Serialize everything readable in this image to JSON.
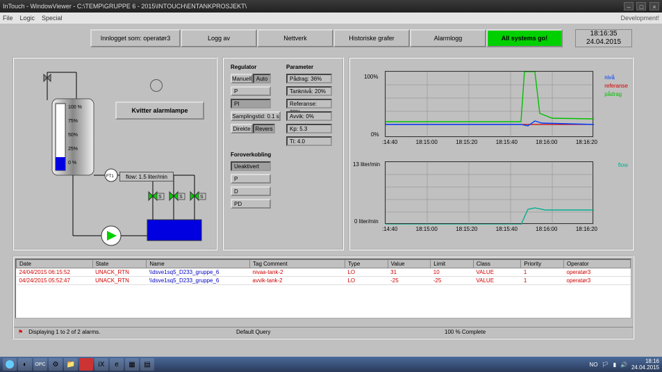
{
  "window": {
    "title": "InTouch - WindowViewer - C:\\TEMP\\GRUPPE 6 - 2015\\INTOUCH\\ENTANKPROSJEKT\\",
    "menu": [
      "File",
      "Logic",
      "Special"
    ],
    "dev": "Development!"
  },
  "topbar": {
    "login": "Innlogget som: operatør3",
    "logoff": "Logg av",
    "network": "Nettverk",
    "hist": "Historiske grafer",
    "alarmlog": "Alarmlogg",
    "status": "All systems go!",
    "time": "18:16:35",
    "date": "24.04.2015"
  },
  "process": {
    "kvitter": "Kvitter alarmlampe",
    "flow": "flow: 1.5 liter/min",
    "ticks": [
      "100 %",
      "75%",
      "50%",
      "25%",
      "0 %"
    ],
    "ft": "FT1"
  },
  "reg": {
    "h1": "Regulator",
    "h2": "Parameter",
    "h3": "Foroverkobling",
    "manuell": "Manuell",
    "auto": "Auto",
    "p": "P",
    "pi": "PI",
    "samp": "Samplingstid: 0.1 s",
    "direkte": "Direkte",
    "revers": "Revers",
    "padrag": "Pådrag: 36%",
    "tanknivaa": "Tanknivå: 20%",
    "ref": "Referanse: 20%",
    "avvik": "Avvik: 0%",
    "kp": "Kp: 5.3",
    "ti": "Ti: 4.0",
    "ff_ua": "Ueaktivert",
    "ff_p": "P",
    "ff_d": "D",
    "ff_pd": "PD"
  },
  "trend": {
    "y100": "100%",
    "y0": "0%",
    "y2a": "13 liter/min",
    "y2b": "0 liter/min",
    "xticks": [
      ":14:40",
      "18:15:00",
      "18:15:20",
      "18:15:40",
      "18:16:00",
      "18:16:20"
    ],
    "leg1": [
      "nivå",
      "referanse",
      "pådrag"
    ],
    "leg1c": [
      "#0040ff",
      "#d00000",
      "#00c000"
    ],
    "leg2": "flow",
    "leg2c": "#00b090"
  },
  "chart_data": [
    {
      "type": "line",
      "title": "",
      "xlabel": "",
      "ylabel": "%",
      "ylim": [
        0,
        100
      ],
      "x": [
        ":14:40",
        "18:15:00",
        "18:15:20",
        "18:15:40",
        "18:15:50",
        "18:16:00",
        "18:16:05",
        "18:16:10",
        "18:16:20",
        "18:16:30"
      ],
      "series": [
        {
          "name": "nivå",
          "values": [
            20,
            20,
            20,
            20,
            20,
            18,
            25,
            22,
            20,
            20
          ]
        },
        {
          "name": "referanse",
          "values": [
            20,
            20,
            20,
            20,
            20,
            20,
            20,
            20,
            20,
            20
          ]
        },
        {
          "name": "pådrag",
          "values": [
            24,
            24,
            24,
            24,
            24,
            100,
            40,
            30,
            28,
            28
          ]
        }
      ]
    },
    {
      "type": "line",
      "title": "",
      "xlabel": "",
      "ylabel": "liter/min",
      "ylim": [
        0,
        13
      ],
      "x": [
        ":14:40",
        "18:15:00",
        "18:15:20",
        "18:15:40",
        "18:15:50",
        "18:16:00",
        "18:16:10",
        "18:16:20",
        "18:16:30"
      ],
      "series": [
        {
          "name": "flow",
          "values": [
            0,
            0,
            0,
            0,
            0,
            3,
            3.2,
            3,
            3
          ]
        }
      ]
    }
  ],
  "alarms": {
    "cols": [
      "Date",
      "State",
      "Name",
      "Tag Comment",
      "Type",
      "Value",
      "Limit",
      "Class",
      "Priority",
      "Operator"
    ],
    "rows": [
      [
        "24/04/2015 06:15:52",
        "UNACK_RTN",
        "\\\\dsve1sq5_D233_gruppe_6",
        "nivaa-tank-2",
        "LO",
        "31",
        "10",
        "VALUE",
        "1",
        "operatør3"
      ],
      [
        "04/24/2015 05:52:47",
        "UNACK_RTN",
        "\\\\dsve1sq5_D233_gruppe_6",
        "avvik-tank-2",
        "LO",
        "-25",
        "-25",
        "VALUE",
        "1",
        "operatør3"
      ]
    ],
    "foot_l": "Displaying 1 to 2 of 2 alarms.",
    "foot_m": "Default Query",
    "foot_r": "100 % Complete"
  },
  "taskbar": {
    "lang": "NO",
    "time": "18:16",
    "date": "24.04.2015"
  }
}
